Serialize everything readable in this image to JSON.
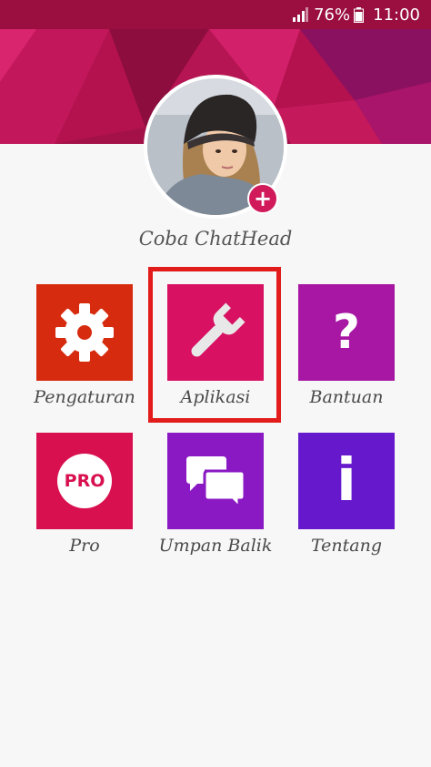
{
  "status_bar": {
    "battery_percent": "76%",
    "time": "11:00"
  },
  "profile": {
    "name": "Coba ChatHead",
    "add_photo_symbol": "+"
  },
  "menu": {
    "items": [
      {
        "label": "Pengaturan",
        "icon": "gear-icon",
        "color": "#d62b0e"
      },
      {
        "label": "Aplikasi",
        "icon": "wrench-icon",
        "color": "#d81162"
      },
      {
        "label": "Bantuan",
        "icon": "question-icon",
        "color": "#a717a3",
        "icon_text": "?"
      },
      {
        "label": "Pro",
        "icon": "pro-badge-icon",
        "color": "#d8104f",
        "icon_text": "PRO"
      },
      {
        "label": "Umpan Balik",
        "icon": "chat-bubbles-icon",
        "color": "#8a19c4"
      },
      {
        "label": "Tentang",
        "icon": "info-icon",
        "color": "#6618cc",
        "icon_text": "i"
      }
    ]
  },
  "colors": {
    "status_bar": "#9a0f3f",
    "header_primary": "#c4185e",
    "highlight": "#e21b1b",
    "add_button": "#d11a5a"
  }
}
